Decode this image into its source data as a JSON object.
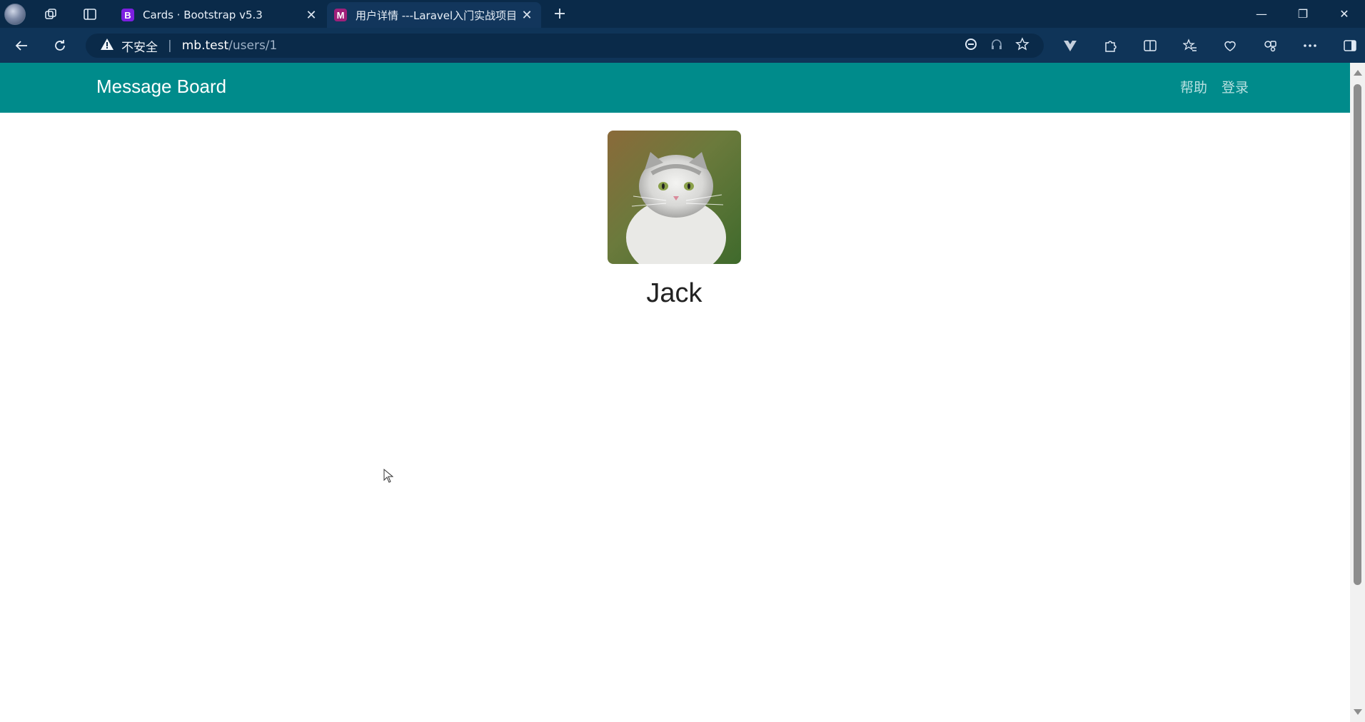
{
  "browser": {
    "tabs": [
      {
        "title": "Cards · Bootstrap v5.3",
        "favicon_letter": "B",
        "active": false
      },
      {
        "title": "用户详情 ---Laravel入门实战项目",
        "favicon_letter": "M",
        "active": true
      }
    ],
    "address": {
      "security_label": "不安全",
      "host": "mb.test",
      "path": "/users/1"
    },
    "icons": {
      "window_minimize": "minimize-icon",
      "window_restore": "restore-icon",
      "window_close": "close-icon"
    }
  },
  "site": {
    "brand": "Message Board",
    "nav": {
      "help": "帮助",
      "login": "登录"
    },
    "colors": {
      "navbar": "#008b8b",
      "text": "#222222"
    }
  },
  "profile": {
    "name": "Jack"
  }
}
